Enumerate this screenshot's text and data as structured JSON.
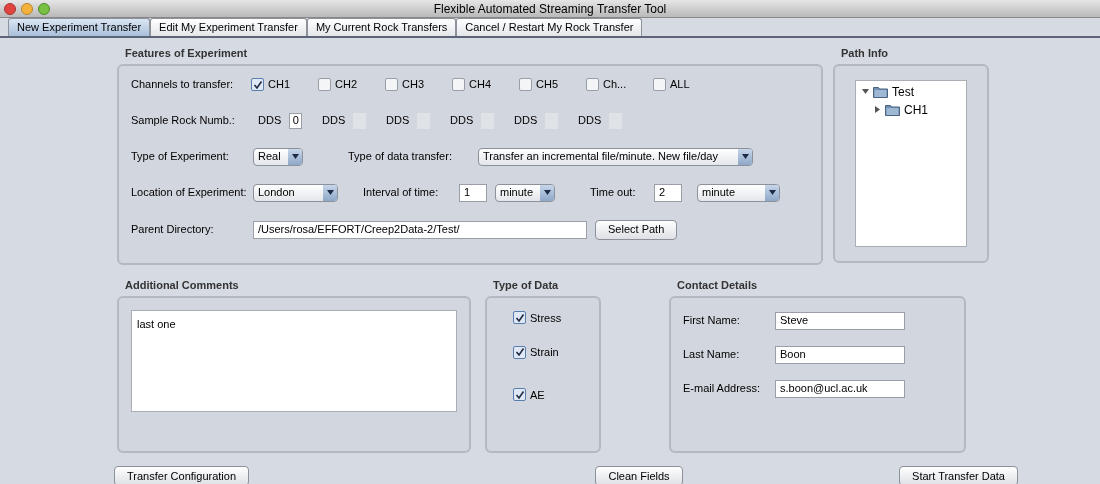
{
  "window": {
    "title": "Flexible Automated Streaming Transfer Tool"
  },
  "tabs": [
    {
      "label": "New Experiment Transfer",
      "selected": true
    },
    {
      "label": "Edit  My  Experiment Transfer",
      "selected": false
    },
    {
      "label": "My Current Rock Transfers",
      "selected": false
    },
    {
      "label": "Cancel / Restart My Rock Transfer",
      "selected": false
    }
  ],
  "features": {
    "title": "Features of Experiment",
    "channels_label": "Channels to transfer:",
    "channels": [
      {
        "label": "CH1",
        "checked": true
      },
      {
        "label": "CH2",
        "checked": false
      },
      {
        "label": "CH3",
        "checked": false
      },
      {
        "label": "CH4",
        "checked": false
      },
      {
        "label": "CH5",
        "checked": false
      },
      {
        "label": "Ch...",
        "checked": false
      },
      {
        "label": "ALL",
        "checked": false
      }
    ],
    "rock_label": "Sample Rock Numb.:",
    "rocks": [
      {
        "label": "DDS",
        "value": "0",
        "disabled": false
      },
      {
        "label": "DDS",
        "disabled": true
      },
      {
        "label": "DDS",
        "disabled": true
      },
      {
        "label": "DDS",
        "disabled": true
      },
      {
        "label": "DDS",
        "disabled": true
      },
      {
        "label": "DDS",
        "disabled": true
      }
    ],
    "experiment_type_label": "Type of Experiment:",
    "experiment_type": "Real",
    "transfer_type_label": "Type of data transfer:",
    "transfer_type": "Transfer an incremental file/minute. New file/day",
    "location_label": "Location of Experiment:",
    "location": "London",
    "interval_label": "Interval of time:",
    "interval": "1",
    "interval_unit": "minute",
    "timeout_label": "Time out:",
    "timeout": "2",
    "timeout_unit": "minute",
    "parent_dir_label": "Parent Directory:",
    "parent_dir": "/Users/rosa/EFFORT/Creep2Data-2/Test/",
    "select_path_button": "Select Path"
  },
  "path_info": {
    "title": "Path Info",
    "tree": [
      {
        "label": "Test",
        "expanded": true,
        "children": [
          {
            "label": "CH1",
            "expanded": false
          }
        ]
      }
    ]
  },
  "comments": {
    "title": "Additional Comments",
    "value": "last one"
  },
  "data_type": {
    "title": "Type of Data",
    "items": [
      {
        "label": "Stress",
        "checked": true
      },
      {
        "label": "Strain",
        "checked": true
      },
      {
        "label": "AE",
        "checked": true
      }
    ]
  },
  "contact": {
    "title": "Contact Details",
    "fields": [
      {
        "label": "First Name:",
        "value": "Steve"
      },
      {
        "label": "Last Name:",
        "value": "Boon"
      },
      {
        "label": "E-mail Address:",
        "value": "s.boon@ucl.ac.uk"
      }
    ]
  },
  "buttons": [
    "Transfer Configuration",
    "Clean Fields",
    "Start Transfer Data"
  ]
}
